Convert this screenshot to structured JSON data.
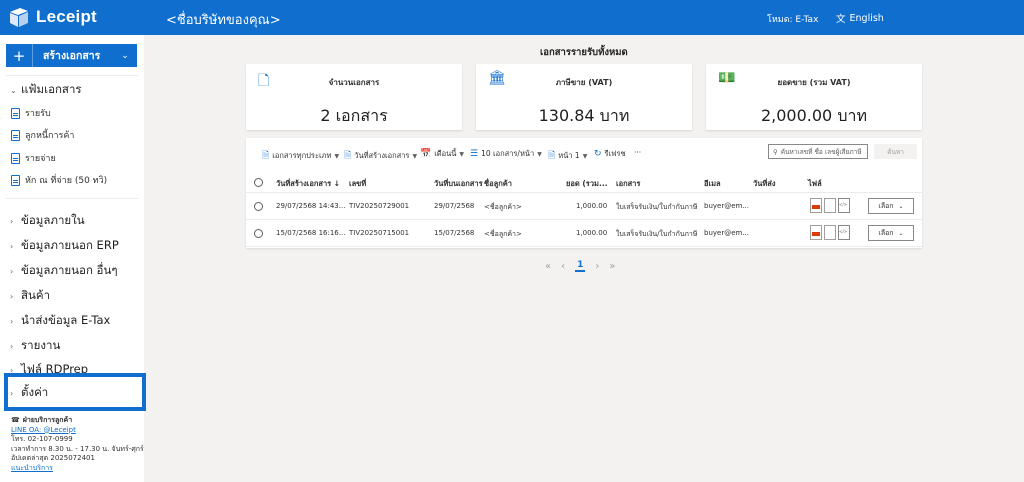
{
  "header": {
    "logo_text": "Leceipt",
    "company": "<ชื่อบริษัทของคุณ>",
    "mode": "โหมด: E-Tax",
    "language": "English"
  },
  "sidebar": {
    "create_button": "สร้างเอกสาร",
    "documents_section": "แฟ้มเอกสาร",
    "document_items": [
      {
        "label": "รายรับ"
      },
      {
        "label": "ลูกหนี้การค้า"
      },
      {
        "label": "รายจ่าย"
      },
      {
        "label": "หัก ณ ที่จ่าย (50 ทวิ)"
      }
    ],
    "sections": [
      {
        "label": "ข้อมูลภายใน"
      },
      {
        "label": "ข้อมูลภายนอก ERP"
      },
      {
        "label": "ข้อมูลภายนอก อื่นๆ"
      },
      {
        "label": "สินค้า"
      },
      {
        "label": "นำส่งข้อมูล E-Tax"
      },
      {
        "label": "รายงาน"
      },
      {
        "label": "ไฟล์ RDPrep"
      },
      {
        "label": "ตั้งค่า"
      }
    ],
    "support": {
      "title": "ฝ่ายบริการลูกค้า",
      "line_oa": "LINE OA: @Leceipt",
      "phone": "โทร. 02-107-0999",
      "hours": "เวลาทำการ 8.30 น. - 17.30 น. จันทร์-ศุกร์",
      "version": "อัปเดตล่าสุด 2025072401",
      "service_link": "แนะนำบริการ"
    }
  },
  "main": {
    "title": "เอกสารรายรับทั้งหมด",
    "cards": [
      {
        "label": "จำนวนเอกสาร",
        "value": "2 เอกสาร",
        "icon": "documents-icon"
      },
      {
        "label": "ภาษีขาย (VAT)",
        "value": "130.84 บาท",
        "icon": "bank-icon"
      },
      {
        "label": "ยอดขาย (รวม VAT)",
        "value": "2,000.00 บาท",
        "icon": "money-icon"
      }
    ],
    "toolbar": {
      "doc_type": "เอกสารทุกประเภท",
      "sort_by": "วันที่สร้างเอกสาร",
      "period": "เดือนนี้",
      "page_size": "10 เอกสาร/หน้า",
      "page": "หน้า 1",
      "refresh": "รีเฟรช",
      "more": "···",
      "search_placeholder": "ค้นหาเลขที่ ชื่อ เลขผู้เสียภาษี",
      "search_button": "ค้นหา"
    },
    "columns": [
      "วันที่สร้างเอกสาร ↓",
      "เลขที่",
      "วันที่บนเอกสาร",
      "ชื่อลูกค้า",
      "ยอด (รวม...",
      "เอกสาร",
      "อีเมล",
      "วันที่ส่ง",
      "ไฟล์"
    ],
    "rows": [
      {
        "created": "29/07/2568 14:43...",
        "number": "TIV20250729001",
        "doc_date": "29/07/2568",
        "customer": "<ชื่อลูกค้า>",
        "amount": "1,000.00",
        "doc_type": "ใบเสร็จรับเงิน/ใบกำกับภาษี",
        "email": "buyer@em...",
        "sent": "",
        "action": "เลือก"
      },
      {
        "created": "15/07/2568 16:16...",
        "number": "TIV20250715001",
        "doc_date": "15/07/2568",
        "customer": "<ชื่อลูกค้า>",
        "amount": "1,000.00",
        "doc_type": "ใบเสร็จรับเงิน/ใบกำกับภาษี",
        "email": "buyer@em...",
        "sent": "",
        "action": "เลือก"
      }
    ],
    "pagination": {
      "current": "1"
    }
  }
}
